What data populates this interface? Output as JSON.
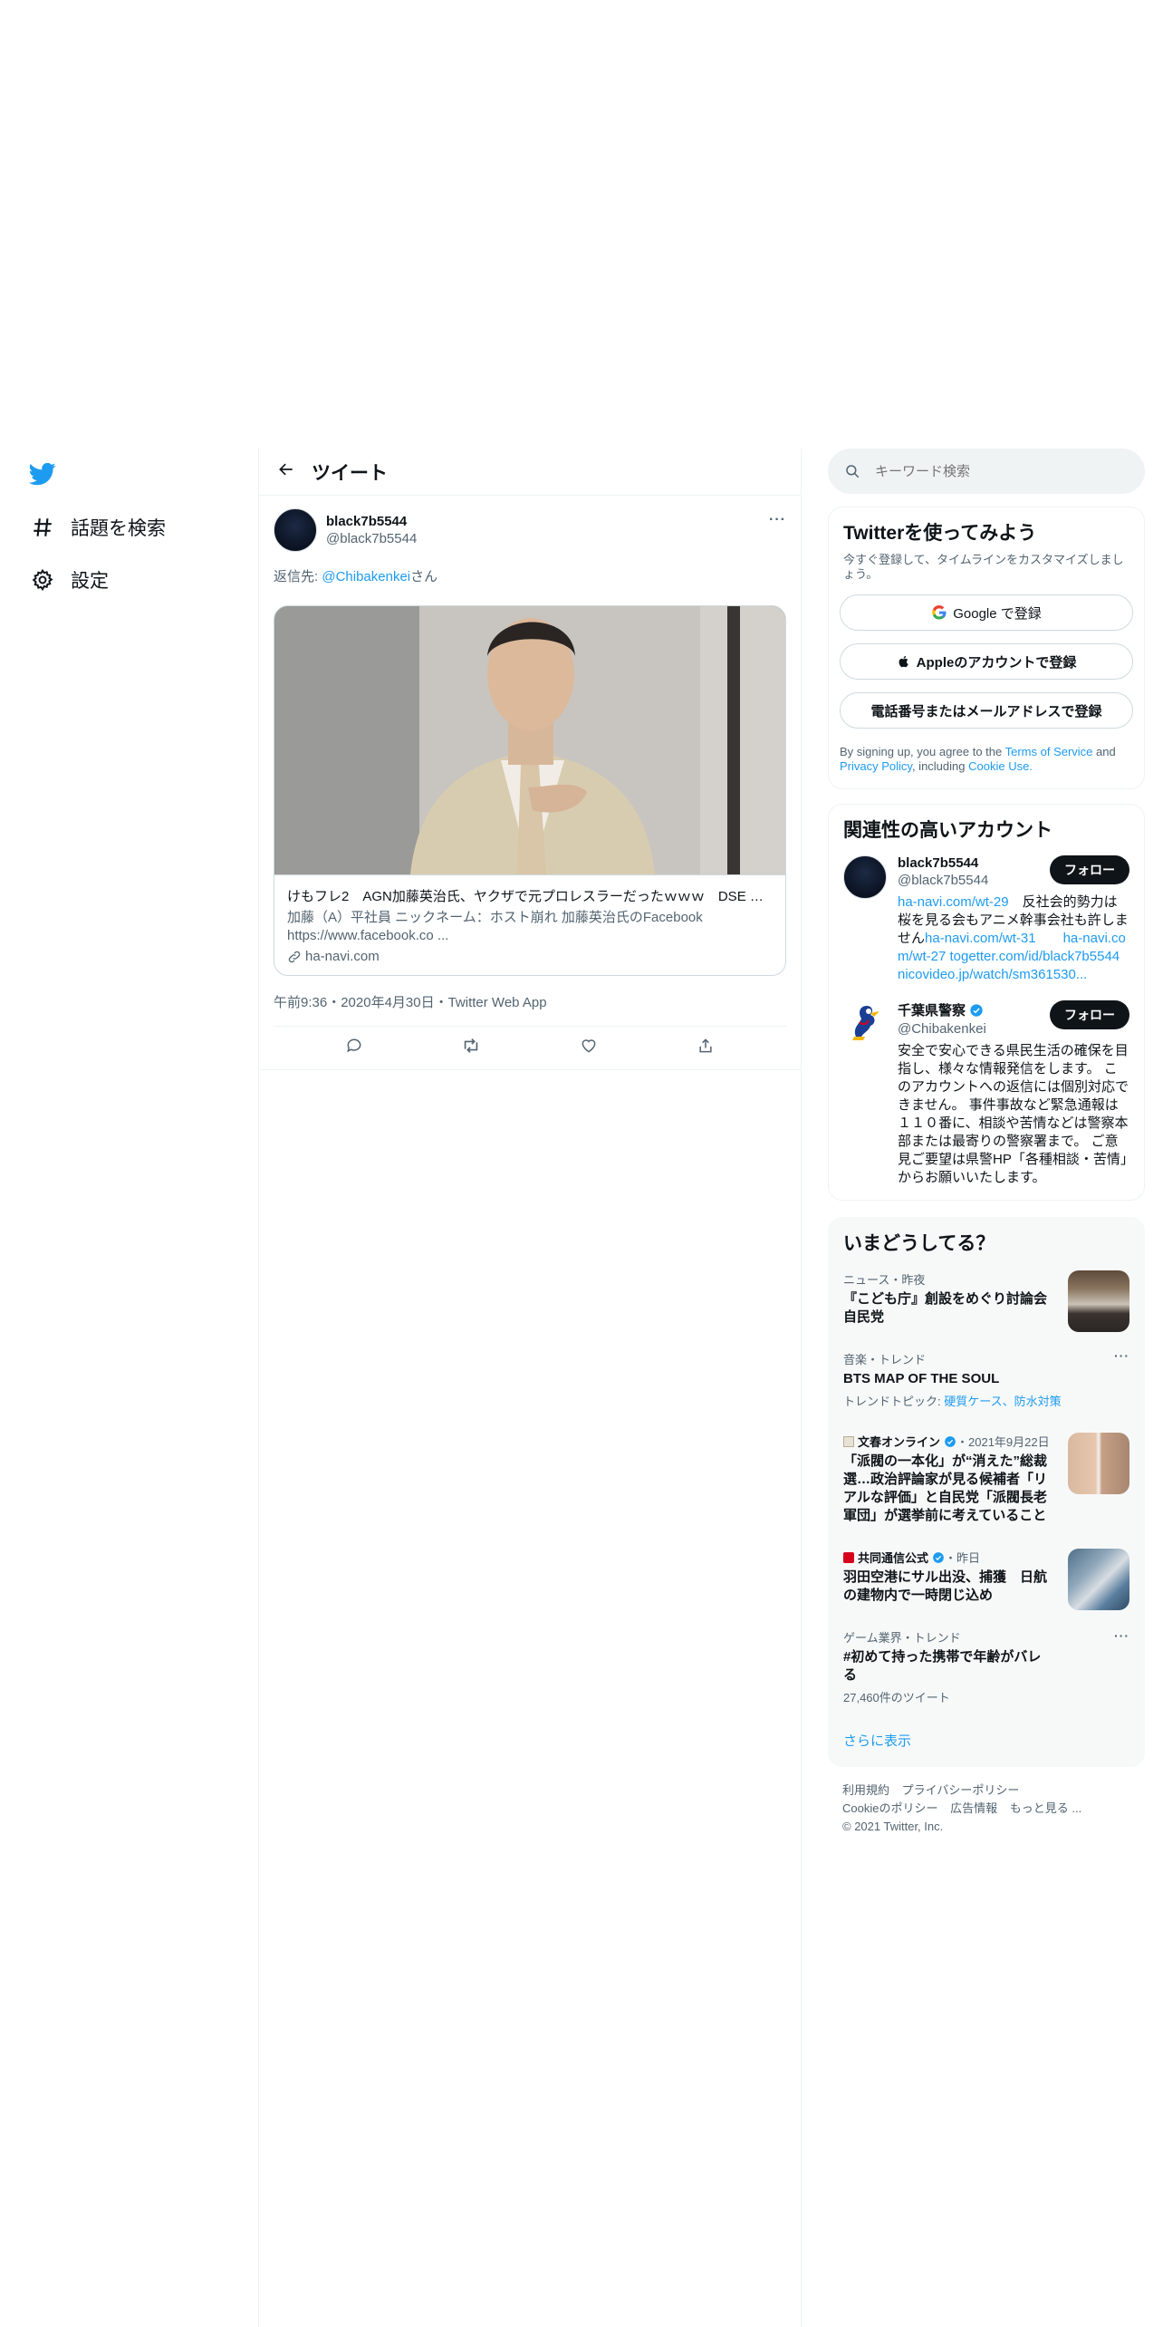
{
  "nav": {
    "explore_label": "話題を検索",
    "settings_label": "設定"
  },
  "header": {
    "title": "ツイート"
  },
  "tweet": {
    "author_name": "black7b5544",
    "author_handle": "@black7b5544",
    "reply_prefix": "返信先: ",
    "reply_to": "@Chibakenkei",
    "reply_suffix": "さん",
    "card": {
      "title": "けもフレ2　AGN加藤英治氏、ヤクザで元プロレスラーだったｗｗｗ　DSE ド...",
      "description": "加藤（A）平社員 ニックネーム：ホスト崩れ 加藤英治氏のFacebook https://www.facebook.co ...",
      "domain": "ha-navi.com"
    },
    "meta": "午前9:36・2020年4月30日・Twitter Web App"
  },
  "search": {
    "placeholder": "キーワード検索"
  },
  "signup": {
    "title": "Twitterを使ってみよう",
    "subtitle": "今すぐ登録して、タイムラインをカスタマイズしましょう。",
    "google": "Google で登録",
    "apple": "Appleのアカウントで登録",
    "phone": "電話番号またはメールアドレスで登録",
    "legal_1": "By signing up, you agree to the ",
    "terms": "Terms of Service",
    "legal_2": " and ",
    "privacy": "Privacy Policy",
    "legal_3": ", including ",
    "cookie": "Cookie Use.",
    "legal_4": ""
  },
  "relevant": {
    "title": "関連性の高いアカウント",
    "follow_label": "フォロー",
    "accounts": [
      {
        "name": "black7b5544",
        "handle": "@black7b5544",
        "bio_link_1": "ha-navi.com/wt-29",
        "bio_text_1": "　反社会的勢力は桜を見る会もアニメ幹事会社も許しません",
        "bio_link_2": "ha-navi.com/wt-31",
        "bio_link_3": "ha-navi.com/wt-27",
        "bio_link_4": "togetter.com/id/black7b5544",
        "bio_link_5": "nicovideo.jp/watch/sm361530..."
      },
      {
        "name": "千葉県警察",
        "handle": "@Chibakenkei",
        "bio": "安全で安心できる県民生活の確保を目指し、様々な情報発信をします。 このアカウントへの返信には個別対応できません。 事件事故など緊急通報は１１０番に、相談や苦情などは警察本部または最寄りの警察署まで。 ご意見ご要望は県警HP「各種相談・苦情」からお願いいたします。"
      }
    ]
  },
  "trends": {
    "title": "いまどうしてる？",
    "items": [
      {
        "context": "ニュース・昨夜",
        "title": "『こども庁』創設をめぐり討論会 自民党"
      },
      {
        "context": "音楽・トレンド",
        "title": "BTS MAP OF THE SOUL",
        "sub_prefix": "トレンドトピック: ",
        "sub_link": "硬質ケース、防水対策"
      },
      {
        "source": "文春オンライン",
        "context": "・2021年9月22日",
        "title": "「派閥の一本化」が“消えた”総裁選…政治評論家が見る候補者「リアルな評価」と自民党「派閥長老軍団」が選挙前に考えていること"
      },
      {
        "source": "共同通信公式",
        "context": "・昨日",
        "title": "羽田空港にサル出没、捕獲　日航の建物内で一時閉じ込め"
      },
      {
        "context": "ゲーム業界・トレンド",
        "title": "#初めて持った携帯で年齢がバレる",
        "sub": "27,460件のツイート"
      }
    ],
    "show_more": "さらに表示"
  },
  "footer": {
    "terms": "利用規約",
    "privacy": "プライバシーポリシー",
    "cookie": "Cookieのポリシー",
    "ads": "広告情報",
    "more": "もっと見る ...",
    "copyright": "© 2021 Twitter, Inc."
  },
  "colors": {
    "accent": "#1d9bf0",
    "text": "#0f1419",
    "secondary": "#536471",
    "verified": "#1d9bf0"
  }
}
